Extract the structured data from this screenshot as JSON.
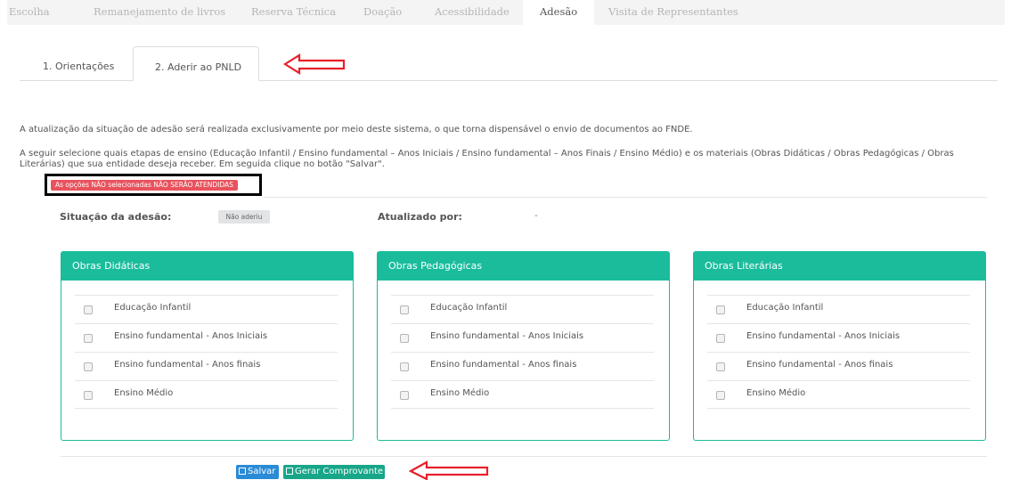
{
  "top_tabs": [
    "Escolha",
    "Remanejamento de livros",
    "Reserva Técnica",
    "Doação",
    "Acessibilidade",
    "Adesão",
    "Visita de Representantes"
  ],
  "active_top_tab": "Adesão",
  "sub_tabs": [
    "1. Orientações",
    "2. Aderir ao PNLD"
  ],
  "active_sub_tab": "2. Aderir ao PNLD",
  "intro": {
    "line1": "A atualização da situação de adesão será realizada exclusivamente por meio deste sistema, o que torna dispensável o envio de documentos ao FNDE.",
    "line2a": "A seguir selecione quais etapas de ensino (Educação Infantil / Ensino fundamental – Anos Iniciais / Ensino fundamental – Anos Finais / Ensino Médio) e os materiais (Obras Didáticas / Obras Pedagógicas / Obras",
    "line2b": "Literárias) que sua entidade deseja receber. Em seguida clique no botão \"Salvar\".",
    "warning": "As opções NÃO selecionadas NÃO SERÃO ATENDIDAS"
  },
  "status": {
    "label": "Situação da adesão:",
    "value": "Não aderiu",
    "updated_label": "Atualizado por:",
    "updated_value": "-"
  },
  "panels": [
    {
      "title": "Obras Didáticas",
      "items": [
        "Educação Infantil",
        "Ensino fundamental - Anos Iniciais",
        "Ensino fundamental - Anos finais",
        "Ensino Médio"
      ]
    },
    {
      "title": "Obras Pedagógicas",
      "items": [
        "Educação Infantil",
        "Ensino fundamental - Anos Iniciais",
        "Ensino fundamental - Anos finais",
        "Ensino Médio"
      ]
    },
    {
      "title": "Obras Literárias",
      "items": [
        "Educação Infantil",
        "Ensino fundamental - Anos Iniciais",
        "Ensino fundamental - Anos finais",
        "Ensino Médio"
      ]
    }
  ],
  "buttons": {
    "save": "Salvar",
    "receipt": "Gerar Comprovante"
  },
  "colors": {
    "panel_header": "#1abc9c",
    "save_button": "#2a8bd6",
    "receipt_button": "#18a689",
    "warning_badge": "#e8525d",
    "annotation_arrow": "#e8202a"
  }
}
